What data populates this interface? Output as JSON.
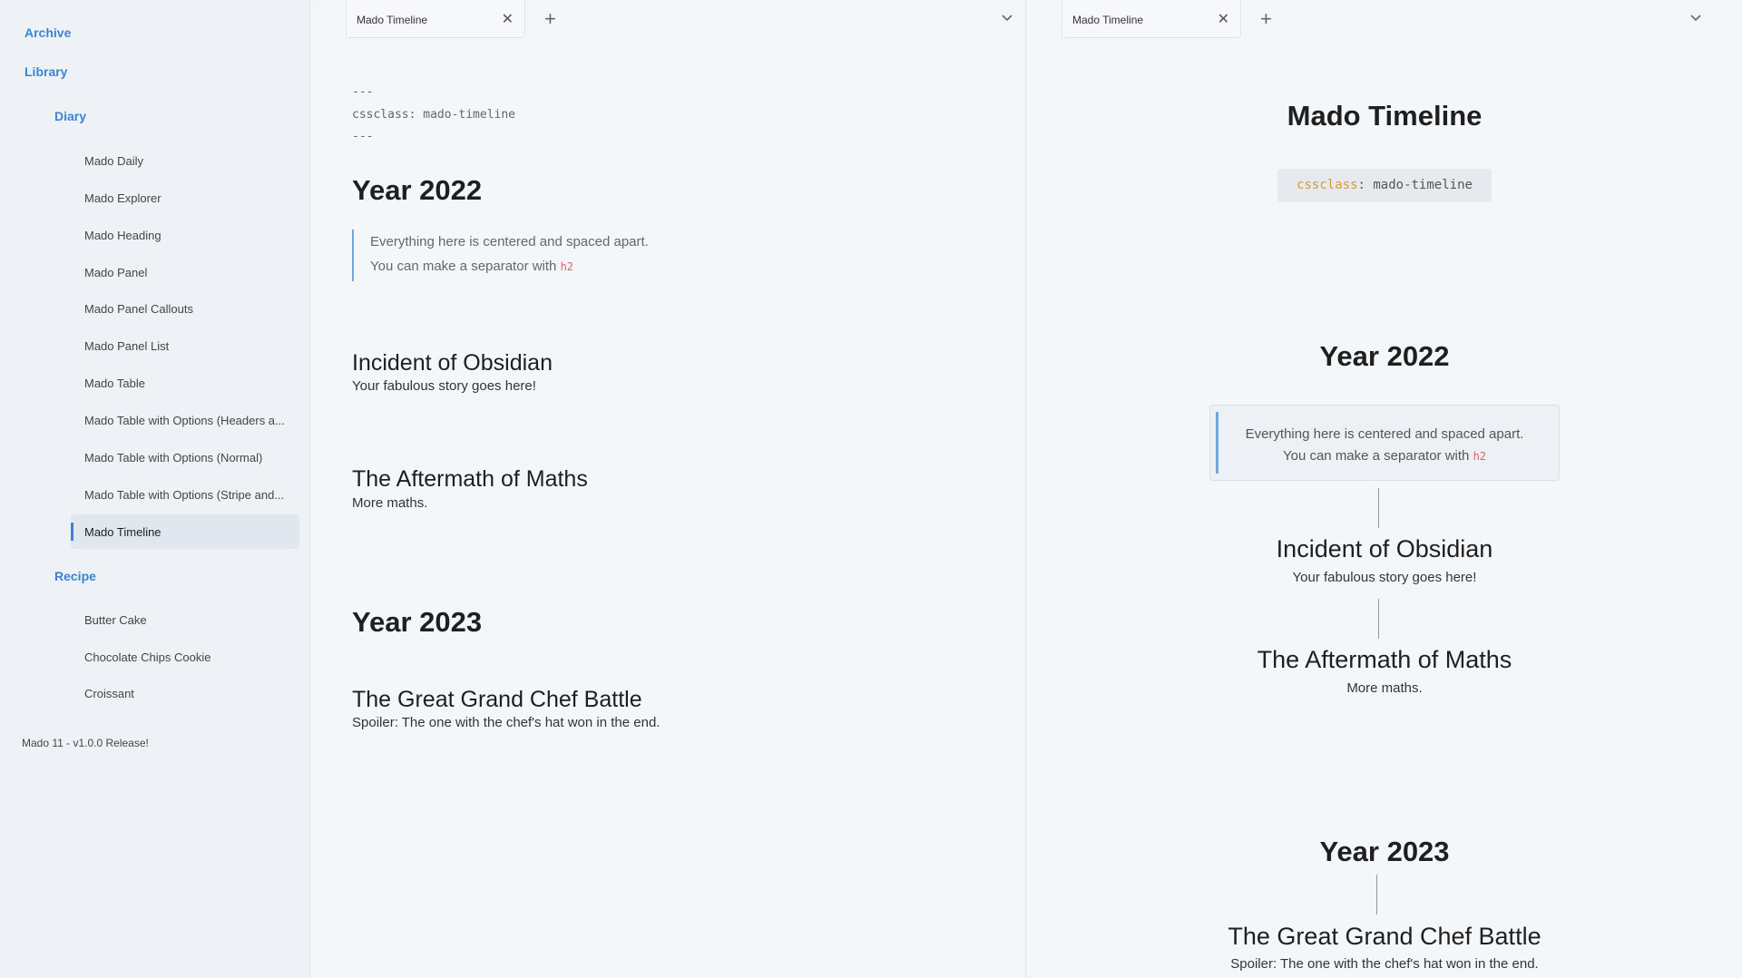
{
  "sidebar": {
    "folders": {
      "archive": "Archive",
      "library": "Library",
      "diary": "Diary",
      "recipe": "Recipe"
    },
    "diary_items": [
      "Mado Daily",
      "Mado Explorer",
      "Mado Heading",
      "Mado Panel",
      "Mado Panel Callouts",
      "Mado Panel List",
      "Mado Table",
      "Mado Table with Options (Headers a...",
      "Mado Table with Options (Normal)",
      "Mado Table with Options (Stripe and...",
      "Mado Timeline"
    ],
    "recipe_items": [
      "Butter Cake",
      "Chocolate Chips Cookie",
      "Croissant"
    ],
    "footer": "Mado 11 - v1.0.0 Release!"
  },
  "left_pane": {
    "tab_title": "Mado Timeline",
    "frontmatter": [
      "---",
      "cssclass: mado-timeline",
      "---"
    ],
    "year_2022": "Year 2022",
    "quote_line1": "Everything here is centered and spaced apart.",
    "quote_line2_prefix": "You can make a separator with ",
    "quote_code": "h2",
    "incident_title": "Incident of Obsidian",
    "incident_text": "Your fabulous story goes here!",
    "maths_title": "The Aftermath of Maths",
    "maths_text": "More maths.",
    "year_2023": "Year 2023",
    "chef_title": "The Great Grand Chef Battle",
    "chef_text": "Spoiler: The one with the chef's hat won in the end."
  },
  "right_pane": {
    "tab_title": "Mado Timeline",
    "title": "Mado Timeline",
    "prop_key": "cssclass",
    "prop_sep": ": ",
    "prop_value": "mado-timeline",
    "year_2022": "Year 2022",
    "quote_line1": "Everything here is centered and spaced apart.",
    "quote_line2_prefix": "You can make a separator with ",
    "quote_code": "h2",
    "incident_title": "Incident of Obsidian",
    "incident_text": "Your fabulous story goes here!",
    "maths_title": "The Aftermath of Maths",
    "maths_text": "More maths.",
    "year_2023": "Year 2023",
    "chef_title": "The Great Grand Chef Battle",
    "chef_text": "Spoiler: The one with the chef's hat won in the end."
  },
  "tab_controls": {
    "close_glyph": "✕",
    "plus_glyph": "+"
  },
  "icons": {
    "close": "close-icon",
    "plus": "plus-icon",
    "chevron": "chevron-down-icon"
  },
  "colors": {
    "accent": "#3a84d2",
    "code": "#e06060",
    "prop_key": "#d39b3b"
  }
}
